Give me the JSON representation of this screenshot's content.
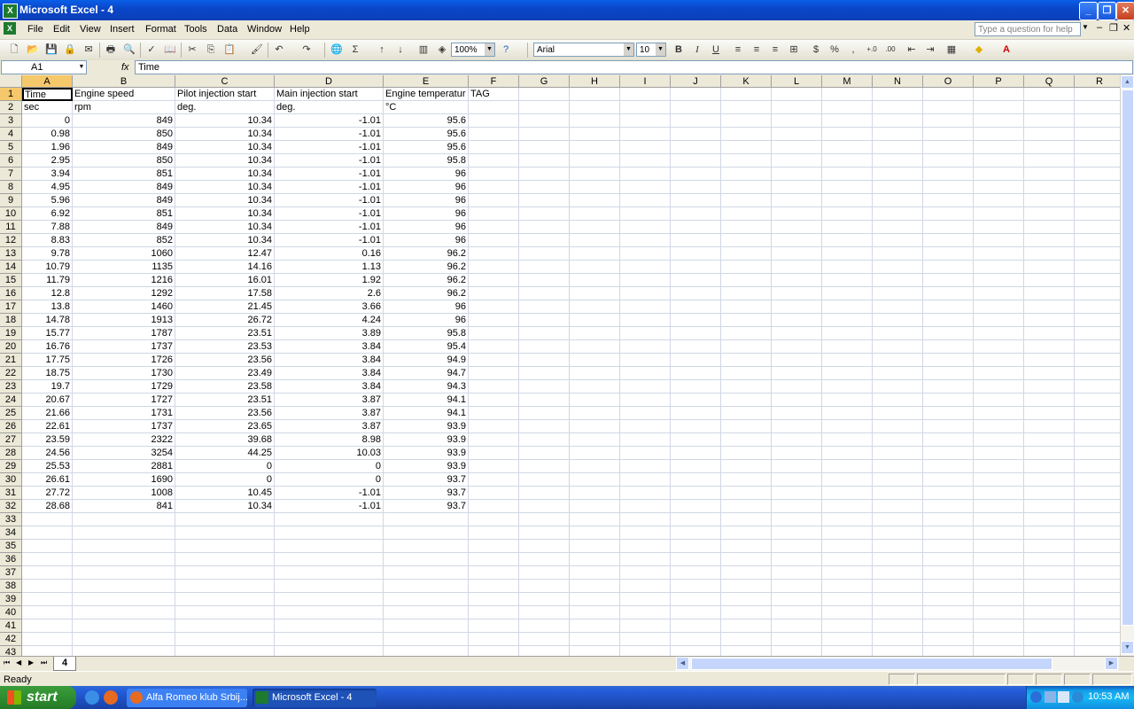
{
  "window": {
    "title": "Microsoft Excel - 4"
  },
  "menu": [
    "File",
    "Edit",
    "View",
    "Insert",
    "Format",
    "Tools",
    "Data",
    "Window",
    "Help"
  ],
  "help_placeholder": "Type a question for help",
  "toolbar": {
    "zoom": "100%",
    "font": "Arial",
    "font_size": "10",
    "bold": "B",
    "italic": "I",
    "underline": "U",
    "currency": "$",
    "percent": "%",
    "comma": ","
  },
  "formula_bar": {
    "name_box": "A1",
    "fx": "fx",
    "content": "Time"
  },
  "columns": [
    "A",
    "B",
    "C",
    "D",
    "E",
    "F",
    "G",
    "H",
    "I",
    "J",
    "K",
    "L",
    "M",
    "N",
    "O",
    "P",
    "Q",
    "R"
  ],
  "sheet": {
    "rows": [
      [
        "Time",
        "Engine speed",
        "Pilot injection start",
        "Main injection start",
        "Engine temperatur",
        "TAG"
      ],
      [
        "sec",
        "rpm",
        "deg.",
        "deg.",
        "°C",
        ""
      ],
      [
        "0",
        "849",
        "10.34",
        "-1.01",
        "95.6",
        ""
      ],
      [
        "0.98",
        "850",
        "10.34",
        "-1.01",
        "95.6",
        ""
      ],
      [
        "1.96",
        "849",
        "10.34",
        "-1.01",
        "95.6",
        ""
      ],
      [
        "2.95",
        "850",
        "10.34",
        "-1.01",
        "95.8",
        ""
      ],
      [
        "3.94",
        "851",
        "10.34",
        "-1.01",
        "96",
        ""
      ],
      [
        "4.95",
        "849",
        "10.34",
        "-1.01",
        "96",
        ""
      ],
      [
        "5.96",
        "849",
        "10.34",
        "-1.01",
        "96",
        ""
      ],
      [
        "6.92",
        "851",
        "10.34",
        "-1.01",
        "96",
        ""
      ],
      [
        "7.88",
        "849",
        "10.34",
        "-1.01",
        "96",
        ""
      ],
      [
        "8.83",
        "852",
        "10.34",
        "-1.01",
        "96",
        ""
      ],
      [
        "9.78",
        "1060",
        "12.47",
        "0.16",
        "96.2",
        ""
      ],
      [
        "10.79",
        "1135",
        "14.16",
        "1.13",
        "96.2",
        ""
      ],
      [
        "11.79",
        "1216",
        "16.01",
        "1.92",
        "96.2",
        ""
      ],
      [
        "12.8",
        "1292",
        "17.58",
        "2.6",
        "96.2",
        ""
      ],
      [
        "13.8",
        "1460",
        "21.45",
        "3.66",
        "96",
        ""
      ],
      [
        "14.78",
        "1913",
        "26.72",
        "4.24",
        "96",
        ""
      ],
      [
        "15.77",
        "1787",
        "23.51",
        "3.89",
        "95.8",
        ""
      ],
      [
        "16.76",
        "1737",
        "23.53",
        "3.84",
        "95.4",
        ""
      ],
      [
        "17.75",
        "1726",
        "23.56",
        "3.84",
        "94.9",
        ""
      ],
      [
        "18.75",
        "1730",
        "23.49",
        "3.84",
        "94.7",
        ""
      ],
      [
        "19.7",
        "1729",
        "23.58",
        "3.84",
        "94.3",
        ""
      ],
      [
        "20.67",
        "1727",
        "23.51",
        "3.87",
        "94.1",
        ""
      ],
      [
        "21.66",
        "1731",
        "23.56",
        "3.87",
        "94.1",
        ""
      ],
      [
        "22.61",
        "1737",
        "23.65",
        "3.87",
        "93.9",
        ""
      ],
      [
        "23.59",
        "2322",
        "39.68",
        "8.98",
        "93.9",
        ""
      ],
      [
        "24.56",
        "3254",
        "44.25",
        "10.03",
        "93.9",
        ""
      ],
      [
        "25.53",
        "2881",
        "0",
        "0",
        "93.9",
        ""
      ],
      [
        "26.61",
        "1690",
        "0",
        "0",
        "93.7",
        ""
      ],
      [
        "27.72",
        "1008",
        "10.45",
        "-1.01",
        "93.7",
        ""
      ],
      [
        "28.68",
        "841",
        "10.34",
        "-1.01",
        "93.7",
        ""
      ]
    ],
    "total_row_numbers": 43
  },
  "sheet_tab": "4",
  "status": "Ready",
  "taskbar": {
    "start": "start",
    "tasks": [
      "Alfa Romeo klub Srbij...",
      "Microsoft Excel - 4"
    ],
    "clock": "10:53 AM"
  },
  "colors": {
    "selected_header": "#f6c86c",
    "titlebar": "#0a47c9",
    "start_green": "#2f8d2f"
  }
}
